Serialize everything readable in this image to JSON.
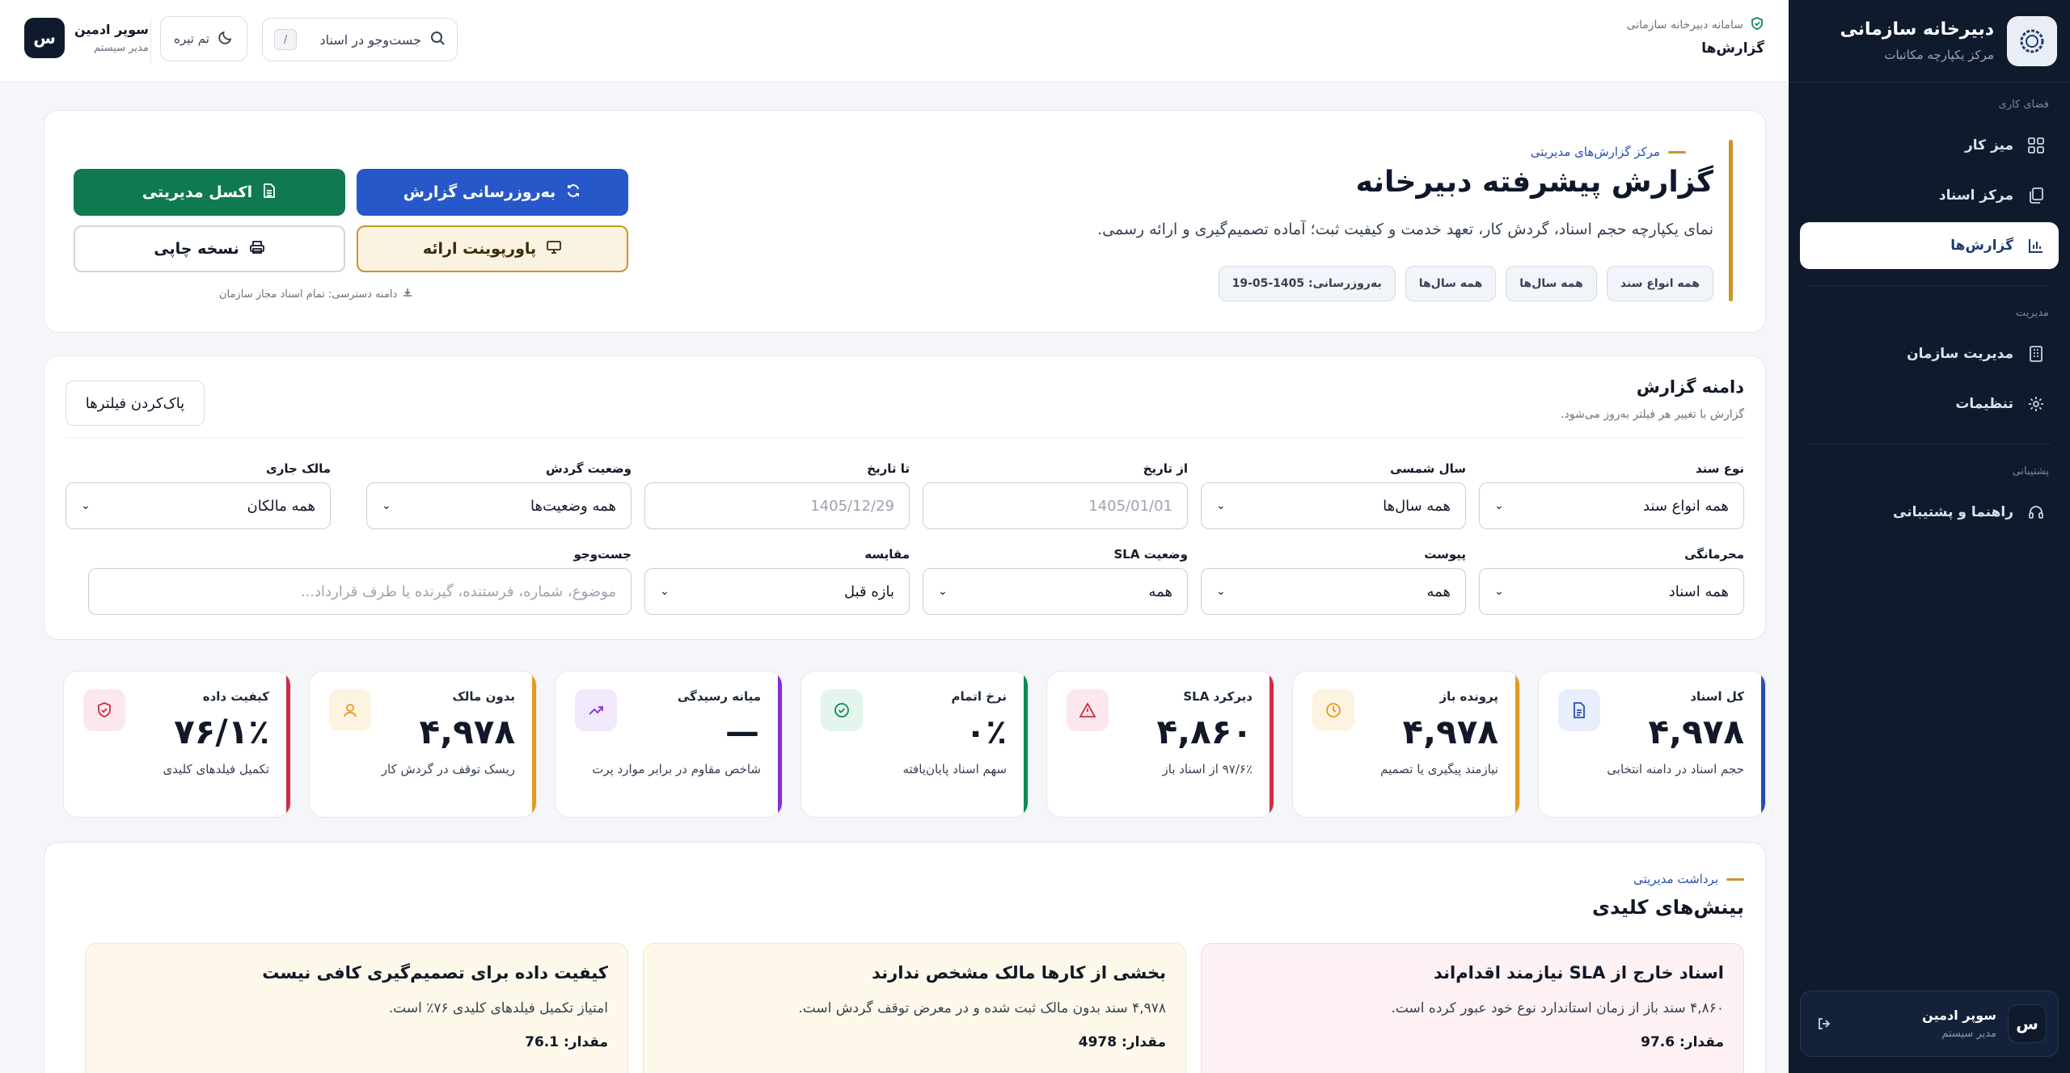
{
  "sidebar": {
    "brand_title": "دبیرخانه سازمانی",
    "brand_sub": "مرکز یکپارچه مکاتبات",
    "section_workspace": "فضای کاری",
    "section_management": "مدیریت",
    "section_support": "پشتیبانی",
    "items": [
      {
        "label": "میز کار",
        "icon": "dashboard-icon"
      },
      {
        "label": "مرکز اسناد",
        "icon": "documents-icon"
      },
      {
        "label": "گزارش‌ها",
        "icon": "chart-icon"
      },
      {
        "label": "مدیریت سازمان",
        "icon": "building-icon"
      },
      {
        "label": "تنظیمات",
        "icon": "gear-icon"
      },
      {
        "label": "راهنما و پشتیبانی",
        "icon": "headset-icon"
      }
    ],
    "user_name": "سوپر ادمین",
    "user_role": "مدیر سیستم",
    "avatar_letter": "س"
  },
  "topbar": {
    "system_name": "سامانه دبیرخانه سازمانی",
    "page_title": "گزارش‌ها",
    "search_label": "جست‌وجو در اسناد",
    "search_shortcut": "/",
    "theme_label": "تم تیره",
    "user_name": "سوپر ادمین",
    "user_role": "مدیر سیستم",
    "avatar_letter": "س"
  },
  "hero": {
    "kicker": "مرکز گزارش‌های مدیریتی",
    "title": "گزارش پیشرفته دبیرخانه",
    "description": "نمای یکپارچه حجم اسناد، گردش کار، تعهد خدمت و کیفیت ثبت؛ آماده تصمیم‌گیری و ارائه رسمی.",
    "chips": [
      "همه انواع سند",
      "همه سال‌ها",
      "همه سال‌ها",
      "به‌روزرسانی: 1405-05-19"
    ],
    "refresh_label": "به‌روزرسانی گزارش",
    "excel_label": "اکسل مدیریتی",
    "ppt_label": "پاورپوینت ارائه",
    "print_label": "نسخه چاپی",
    "scope_note": "دامنه دسترسی: تمام اسناد مجاز سازمان"
  },
  "filters": {
    "title": "دامنه گزارش",
    "subtitle": "گزارش با تغییر هر فیلتر به‌روز می‌شود.",
    "clear_label": "پاک‌کردن فیلترها",
    "row1": [
      {
        "label": "نوع سند",
        "value": "همه انواع سند",
        "kind": "select"
      },
      {
        "label": "سال شمسی",
        "value": "همه سال‌ها",
        "kind": "select"
      },
      {
        "label": "از تاریخ",
        "value": "1405/01/01",
        "kind": "date"
      },
      {
        "label": "تا تاریخ",
        "value": "1405/12/29",
        "kind": "date"
      },
      {
        "label": "وضعیت گردش",
        "value": "همه وضعیت‌ها",
        "kind": "select"
      },
      {
        "label": "مالک جاری",
        "value": "همه مالکان",
        "kind": "select"
      }
    ],
    "row2": [
      {
        "label": "محرمانگی",
        "value": "همه اسناد",
        "kind": "select"
      },
      {
        "label": "پیوست",
        "value": "همه",
        "kind": "select"
      },
      {
        "label": "وضعیت SLA",
        "value": "همه",
        "kind": "select"
      },
      {
        "label": "مقایسه",
        "value": "بازه قبل",
        "kind": "select"
      }
    ],
    "search_label": "جست‌وجو",
    "search_placeholder": "موضوع، شماره، فرستنده، گیرنده یا طرف قرارداد..."
  },
  "kpis": [
    {
      "label": "کل اسناد",
      "value": "۴,۹۷۸",
      "note": "حجم اسناد در دامنه انتخابی",
      "color": "#2450b0",
      "icon": "file-icon",
      "icon_bg": "#e8eefb"
    },
    {
      "label": "پرونده باز",
      "value": "۴,۹۷۸",
      "note": "نیازمند پیگیری یا تصمیم",
      "color": "#e39b1c",
      "icon": "clock-icon",
      "icon_bg": "#fdf3e1"
    },
    {
      "label": "دیرکرد SLA",
      "value": "۴,۸۶۰",
      "note": "۹۷/۶٪ از اسناد باز",
      "color": "#d02b45",
      "icon": "warning-icon",
      "icon_bg": "#fce8ec"
    },
    {
      "label": "نرخ اتمام",
      "value": "۰٪",
      "note": "سهم اسناد پایان‌یافته",
      "color": "#0f8a56",
      "icon": "check-circle-icon",
      "icon_bg": "#e3f5ec"
    },
    {
      "label": "میانه رسیدگی",
      "value": "—",
      "note": "شاخص مقاوم در برابر موارد پرت",
      "color": "#8a2bd6",
      "icon": "trend-icon",
      "icon_bg": "#f2e8fc"
    },
    {
      "label": "بدون مالک",
      "value": "۴,۹۷۸",
      "note": "ریسک توقف در گردش کار",
      "color": "#e39b1c",
      "icon": "user-icon",
      "icon_bg": "#fdf3e1"
    },
    {
      "label": "کیفیت داده",
      "value": "۷۶/۱٪",
      "note": "تکمیل فیلدهای کلیدی",
      "color": "#d02b45",
      "icon": "shield-icon",
      "icon_bg": "#fce8ec"
    }
  ],
  "insights": {
    "kicker": "برداشت مدیریتی",
    "title": "بینش‌های کلیدی",
    "cards": [
      {
        "title": "اسناد خارج از SLA نیازمند اقدام‌اند",
        "desc": "۴,۸۶۰ سند باز از زمان استاندارد نوع خود عبور کرده است.",
        "value_label": "مقدار:",
        "value": "97.6",
        "bg": "#fdf1f3",
        "border": "#f6d9de"
      },
      {
        "title": "بخشی از کارها مالک مشخص ندارند",
        "desc": "۴,۹۷۸ سند بدون مالک ثبت شده و در معرض توقف گردش است.",
        "value_label": "مقدار:",
        "value": "4978",
        "bg": "#fdf8ea",
        "border": "#f1e6c6"
      },
      {
        "title": "کیفیت داده برای تصمیم‌گیری کافی نیست",
        "desc": "امتیاز تکمیل فیلدهای کلیدی ۷۶٪ است.",
        "value_label": "مقدار:",
        "value": "76.1",
        "bg": "#fdf8ea",
        "border": "#f1e6c6"
      }
    ]
  }
}
